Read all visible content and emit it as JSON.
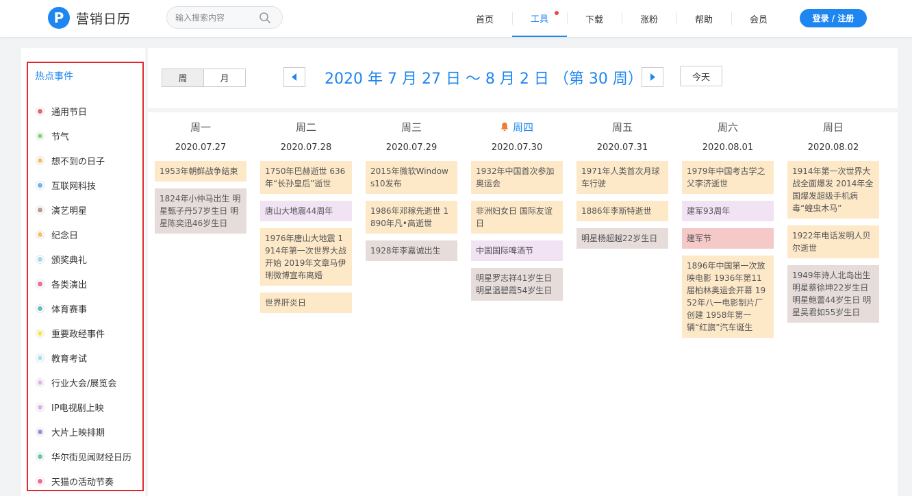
{
  "header": {
    "logo_letter": "P",
    "logo_text": "营销日历",
    "search_placeholder": "输入搜索内容",
    "nav": [
      {
        "label": "首页"
      },
      {
        "label": "工具"
      },
      {
        "label": "下载"
      },
      {
        "label": "涨粉"
      },
      {
        "label": "帮助"
      },
      {
        "label": "会员"
      }
    ],
    "active_nav": "工具",
    "login_label": "登录 / 注册"
  },
  "sidebar": {
    "title": "热点事件",
    "categories": [
      {
        "label": "通用节日",
        "color": "#e06a74"
      },
      {
        "label": "节气",
        "color": "#8fd18a"
      },
      {
        "label": "想不到の日子",
        "color": "#f5c26b"
      },
      {
        "label": "互联网科技",
        "color": "#6fb6ee"
      },
      {
        "label": "演艺明星",
        "color": "#b49a95"
      },
      {
        "label": "纪念日",
        "color": "#f5c26b"
      },
      {
        "label": "颁奖典礼",
        "color": "#9fd9f0"
      },
      {
        "label": "各类演出",
        "color": "#ec6d98"
      },
      {
        "label": "体育赛事",
        "color": "#5ec4b7"
      },
      {
        "label": "重要政经事件",
        "color": "#f5e84a"
      },
      {
        "label": "教育考试",
        "color": "#aadff2"
      },
      {
        "label": "行业大会/展览会",
        "color": "#e3b5e6"
      },
      {
        "label": "IP电视剧上映",
        "color": "#d9b3ea"
      },
      {
        "label": "大片上映排期",
        "color": "#8f98d4"
      },
      {
        "label": "华尔街见闻财经日历",
        "color": "#6cc7ab"
      },
      {
        "label": "天猫の活动节奏",
        "color": "#ec6d98"
      }
    ]
  },
  "toolbar": {
    "view_week": "周",
    "view_month": "月",
    "range_title": "2020 年 7 月 27 日 ～ 8 月 2 日 （第 30 周）",
    "today_label": "今天"
  },
  "days": [
    {
      "name": "周一",
      "date": "2020.07.27",
      "today": false,
      "events": [
        {
          "text": "1953年朝鲜战争结束",
          "color": "orange"
        },
        {
          "text": "1824年小仲马出生 明星甄子丹57岁生日 明星陈奕迅46岁生日",
          "color": "gray"
        }
      ]
    },
    {
      "name": "周二",
      "date": "2020.07.28",
      "today": false,
      "events": [
        {
          "text": "1750年巴赫逝世 636年“长孙皇后”逝世",
          "color": "orange"
        },
        {
          "text": "唐山大地震44周年",
          "color": "purple"
        },
        {
          "text": "1976年唐山大地震 1914年第一次世界大战开始 2019年文章马伊琍微博宣布离婚",
          "color": "orange"
        },
        {
          "text": "世界肝炎日",
          "color": "orange"
        }
      ]
    },
    {
      "name": "周三",
      "date": "2020.07.29",
      "today": false,
      "events": [
        {
          "text": "2015年微软Windows10发布",
          "color": "orange"
        },
        {
          "text": "1986年邓稼先逝世 1890年凡•高逝世",
          "color": "orange"
        },
        {
          "text": "1928年李嘉诚出生",
          "color": "gray"
        }
      ]
    },
    {
      "name": "周四",
      "date": "2020.07.30",
      "today": true,
      "events": [
        {
          "text": "1932年中国首次参加奥运会",
          "color": "orange"
        },
        {
          "text": "非洲妇女日 国际友谊日",
          "color": "orange"
        },
        {
          "text": "中国国际啤酒节",
          "color": "purple"
        },
        {
          "text": "明星罗志祥41岁生日 明星温碧霞54岁生日",
          "color": "gray"
        }
      ]
    },
    {
      "name": "周五",
      "date": "2020.07.31",
      "today": false,
      "events": [
        {
          "text": "1971年人类首次月球车行驶",
          "color": "orange"
        },
        {
          "text": "1886年李斯特逝世",
          "color": "orange"
        },
        {
          "text": "明星杨超越22岁生日",
          "color": "gray"
        }
      ]
    },
    {
      "name": "周六",
      "date": "2020.08.01",
      "today": false,
      "events": [
        {
          "text": "1979年中国考古学之父李济逝世",
          "color": "orange"
        },
        {
          "text": "建军93周年",
          "color": "purple"
        },
        {
          "text": "建军节",
          "color": "red"
        },
        {
          "text": "1896年中国第一次放映电影 1936年第11届柏林奥运会开幕 1952年八一电影制片厂创建 1958年第一辆“红旗”汽车诞生",
          "color": "orange"
        }
      ]
    },
    {
      "name": "周日",
      "date": "2020.08.02",
      "today": false,
      "events": [
        {
          "text": "1914年第一次世界大战全面爆发 2014年全国爆发超级手机病毒“蝗虫木马”",
          "color": "orange"
        },
        {
          "text": "1922年电话发明人贝尔逝世",
          "color": "orange"
        },
        {
          "text": "1949年诗人北岛出生 明星蔡徐坤22岁生日 明星鲍蕾44岁生日 明星吴君如55岁生日",
          "color": "gray"
        }
      ]
    }
  ]
}
